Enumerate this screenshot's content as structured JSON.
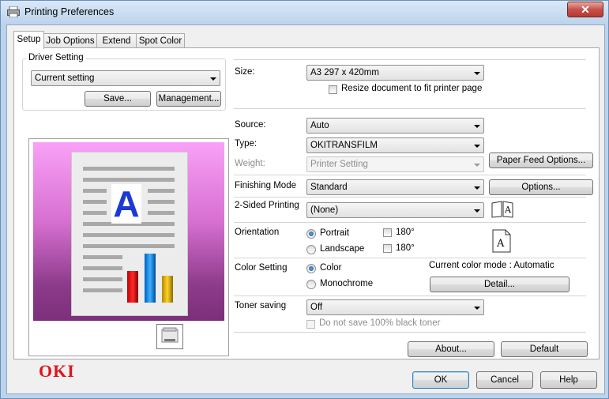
{
  "window": {
    "title": "Printing Preferences",
    "close_label": "✕"
  },
  "tabs": [
    {
      "label": "Setup"
    },
    {
      "label": "Job Options"
    },
    {
      "label": "Extend"
    },
    {
      "label": "Spot Color"
    }
  ],
  "driver_setting": {
    "label": "Driver Setting",
    "value": "Current setting",
    "save_label": "Save...",
    "management_label": "Management..."
  },
  "size": {
    "label": "Size:",
    "value": "A3 297 x 420mm",
    "resize_label": "Resize document to fit printer page",
    "resize_checked": false
  },
  "source": {
    "label": "Source:",
    "value": "Auto"
  },
  "type": {
    "label": "Type:",
    "value": "OKITRANSFILM"
  },
  "weight": {
    "label": "Weight:",
    "value": "Printer Setting",
    "disabled": true
  },
  "paper_feed_options_label": "Paper Feed Options...",
  "finishing": {
    "label": "Finishing Mode",
    "value": "Standard",
    "options_label": "Options..."
  },
  "two_sided": {
    "label": "2-Sided Printing",
    "value": "(None)"
  },
  "orientation": {
    "label": "Orientation",
    "portrait_label": "Portrait",
    "landscape_label": "Landscape",
    "selected": "Portrait",
    "rotate_label_1": "180°",
    "rotate_label_2": "180°"
  },
  "color_setting": {
    "label": "Color Setting",
    "color_label": "Color",
    "mono_label": "Monochrome",
    "selected": "Color",
    "current_mode": "Current color mode : Automatic",
    "detail_label": "Detail..."
  },
  "toner_saving": {
    "label": "Toner saving",
    "value": "Off",
    "no_black_label": "Do not save 100% black toner"
  },
  "about_label": "About...",
  "default_label": "Default",
  "brand": "OKI",
  "preview": {
    "letter": "A"
  },
  "footer": {
    "ok_label": "OK",
    "cancel_label": "Cancel",
    "help_label": "Help"
  },
  "colors": {
    "accent_red": "#e0141e",
    "preview_top": "#f9a1f7",
    "preview_bottom": "#7c2f7a",
    "letter_blue": "#1a39d5"
  }
}
